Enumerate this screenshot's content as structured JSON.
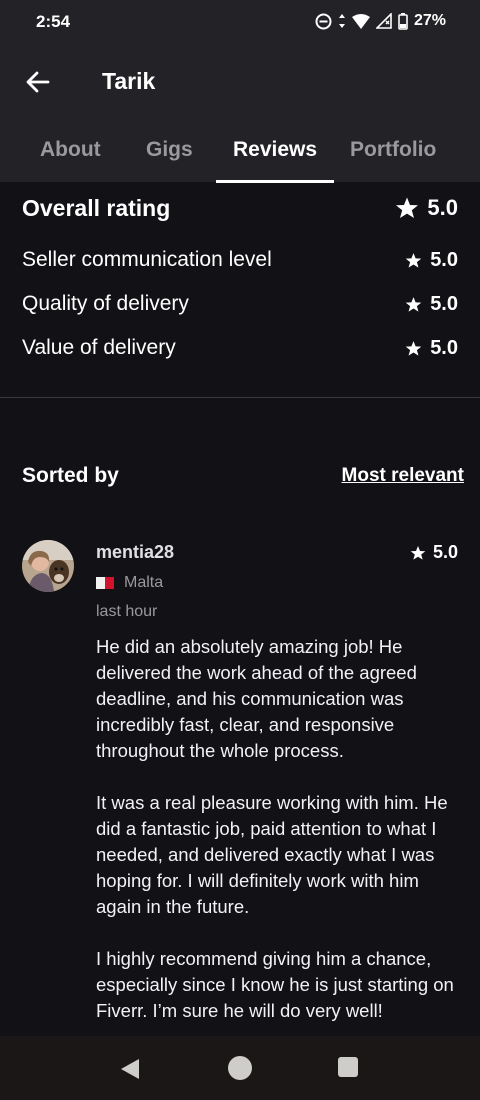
{
  "status_bar": {
    "time": "2:54",
    "battery": "27%",
    "icons": [
      "dnd-icon",
      "data-arrows-icon",
      "wifi-icon",
      "signal-icon",
      "battery-icon"
    ]
  },
  "header": {
    "title": "Tarik",
    "back_icon": "arrow-left-icon"
  },
  "tabs": [
    {
      "label": "About",
      "active": false
    },
    {
      "label": "Gigs",
      "active": false
    },
    {
      "label": "Reviews",
      "active": true
    },
    {
      "label": "Portfolio",
      "active": false
    }
  ],
  "ratings": {
    "overall": {
      "label": "Overall rating",
      "value": "5.0"
    },
    "items": [
      {
        "label": "Seller communication level",
        "value": "5.0"
      },
      {
        "label": "Quality of delivery",
        "value": "5.0"
      },
      {
        "label": "Value of delivery",
        "value": "5.0"
      }
    ]
  },
  "sort": {
    "label": "Sorted by",
    "value": "Most relevant"
  },
  "review": {
    "username": "mentia28",
    "rating": "5.0",
    "country": "Malta",
    "time": "last hour",
    "paragraphs": [
      "He did an absolutely amazing job! He delivered the work ahead of the agreed deadline, and his communication was incredibly fast, clear, and responsive throughout the whole process.",
      "It was a real pleasure working with him. He did a fantastic job, paid attention to what I needed, and delivered exactly what I was hoping for. I will definitely work with him again in the future.",
      "I highly recommend giving him a chance, especially since I know he is just starting on Fiverr. I’m sure he will do very well!"
    ]
  },
  "colors": {
    "background": "#121115",
    "appbar": "#232226",
    "muted_text": "#9a999e",
    "navbar": "#1b1716"
  }
}
